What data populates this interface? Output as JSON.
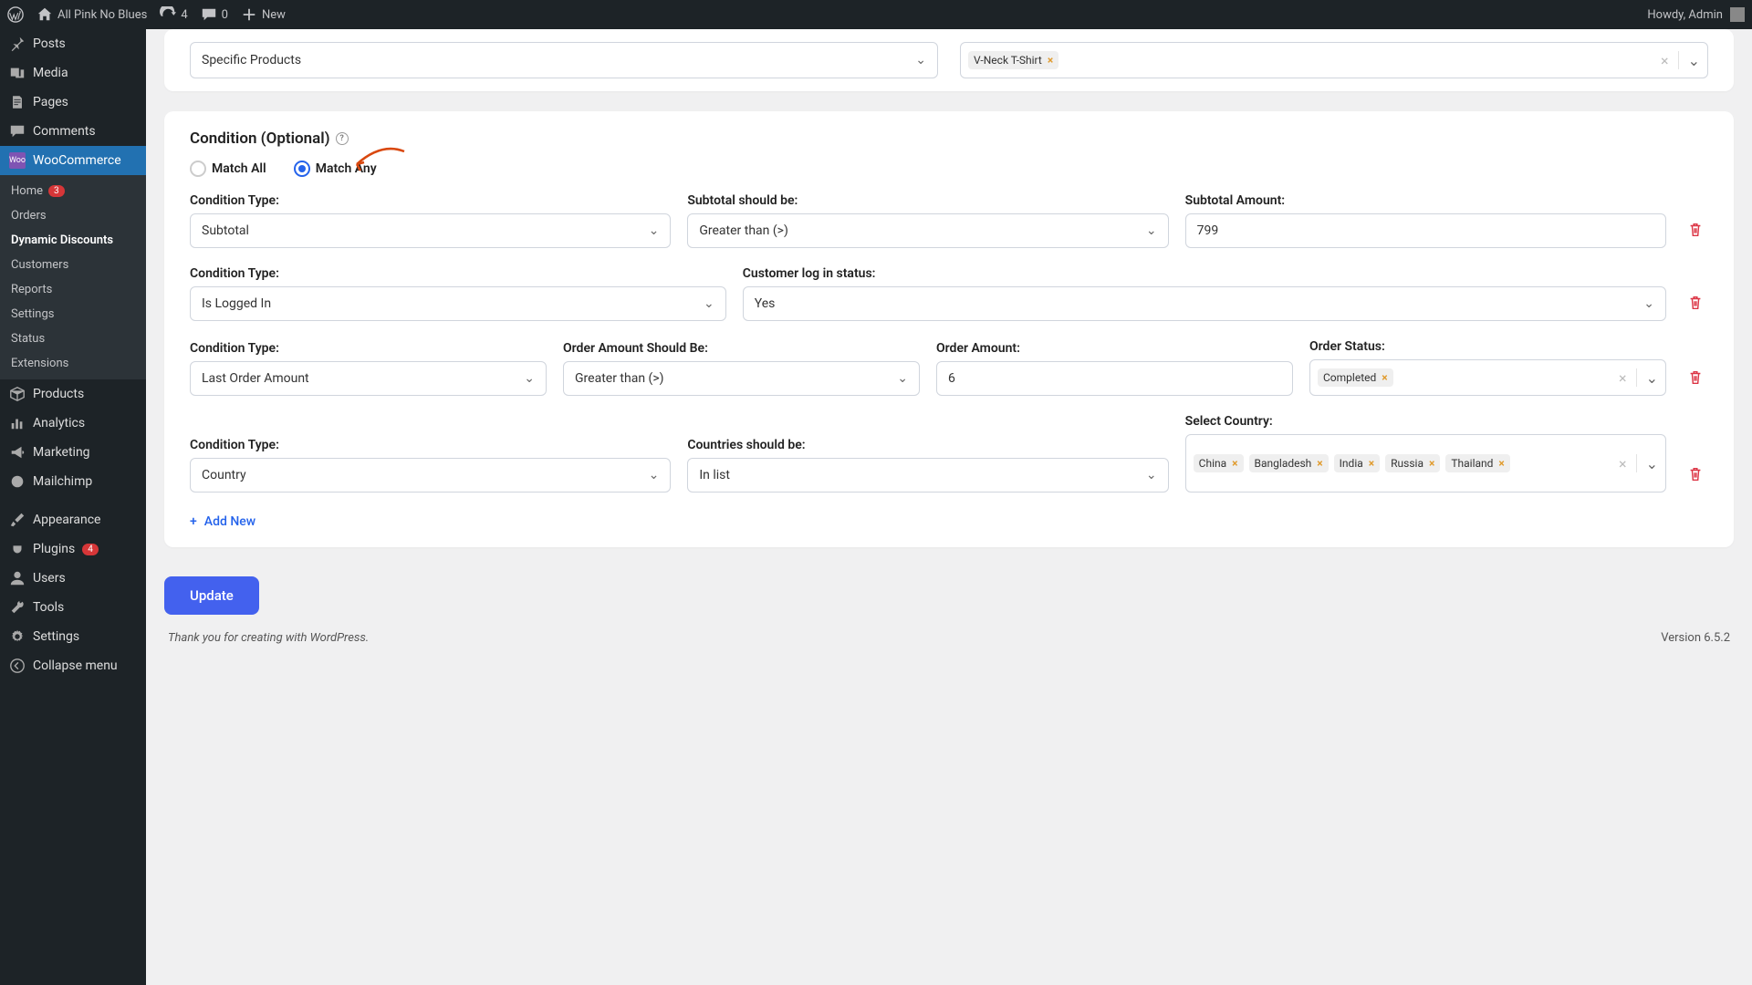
{
  "adminbar": {
    "site_name": "All Pink No Blues",
    "updates": "4",
    "comments": "0",
    "new_label": "New",
    "greeting": "Howdy, Admin"
  },
  "sidebar": {
    "posts": "Posts",
    "media": "Media",
    "pages": "Pages",
    "comments": "Comments",
    "woocommerce": "WooCommerce",
    "woo_sub": {
      "home": "Home",
      "home_badge": "3",
      "orders": "Orders",
      "dynamic_discounts": "Dynamic Discounts",
      "customers": "Customers",
      "reports": "Reports",
      "settings": "Settings",
      "status": "Status",
      "extensions": "Extensions"
    },
    "products": "Products",
    "analytics": "Analytics",
    "marketing": "Marketing",
    "mailchimp": "Mailchimp",
    "appearance": "Appearance",
    "plugins": "Plugins",
    "plugins_badge": "4",
    "users": "Users",
    "tools": "Tools",
    "settings": "Settings",
    "collapse": "Collapse menu"
  },
  "top": {
    "products_type": "Specific Products",
    "product_tag": "V-Neck T-Shirt"
  },
  "cond": {
    "title": "Condition (Optional)",
    "match_all": "Match All",
    "match_any": "Match Any",
    "rows": [
      {
        "type_label": "Condition Type:",
        "type_val": "Subtotal",
        "col2_label": "Subtotal should be:",
        "col2_val": "Greater than (>)",
        "col3_label": "Subtotal Amount:",
        "col3_val": "799"
      },
      {
        "type_label": "Condition Type:",
        "type_val": "Is Logged In",
        "col2_label": "Customer log in status:",
        "col2_val": "Yes"
      },
      {
        "type_label": "Condition Type:",
        "type_val": "Last Order Amount",
        "col2_label": "Order Amount Should Be:",
        "col2_val": "Greater than (>)",
        "col3_label": "Order Amount:",
        "col3_val": "6",
        "col4_label": "Order Status:",
        "col4_tag": "Completed"
      },
      {
        "type_label": "Condition Type:",
        "type_val": "Country",
        "col2_label": "Countries should be:",
        "col2_val": "In list",
        "col3_label": "Select Country:",
        "tags": [
          "China",
          "Bangladesh",
          "India",
          "Russia",
          "Thailand"
        ]
      }
    ],
    "add_new": "Add New"
  },
  "update": "Update",
  "footer": {
    "thanks": "Thank you for creating with WordPress.",
    "version": "Version 6.5.2"
  },
  "icons": {
    "plus": "+"
  }
}
